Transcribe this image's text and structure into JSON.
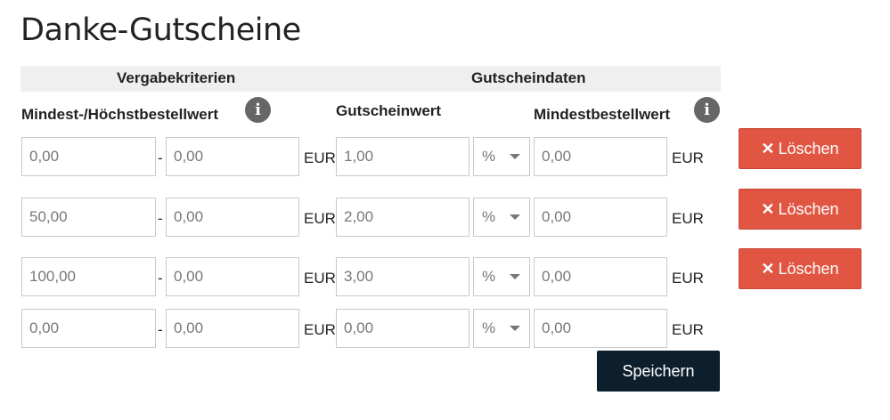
{
  "page": {
    "title": "Danke-Gutscheine"
  },
  "header": {
    "criteria_label": "Vergabekriterien",
    "voucher_label": "Gutscheindaten"
  },
  "subheaders": {
    "order_value": "Mindest-/Höchstbestellwert",
    "voucher_value": "Gutscheinwert",
    "min_order": "Mindestbestellwert",
    "info_glyph": "i"
  },
  "currency": "EUR",
  "separator": "-",
  "rows": [
    {
      "min": "0,00",
      "max": "0,00",
      "value": "1,00",
      "type": "%",
      "min_order": "0,00"
    },
    {
      "min": "50,00",
      "max": "0,00",
      "value": "2,00",
      "type": "%",
      "min_order": "0,00"
    },
    {
      "min": "100,00",
      "max": "0,00",
      "value": "3,00",
      "type": "%",
      "min_order": "0,00"
    },
    {
      "min": "0,00",
      "max": "0,00",
      "value": "0,00",
      "type": "%",
      "min_order": "0,00"
    }
  ],
  "buttons": {
    "delete_label": "Löschen",
    "delete_icon": "✕",
    "save_label": "Speichern"
  },
  "colors": {
    "delete": "#e05643",
    "save": "#0d1f2d",
    "header_band": "#efefef"
  }
}
